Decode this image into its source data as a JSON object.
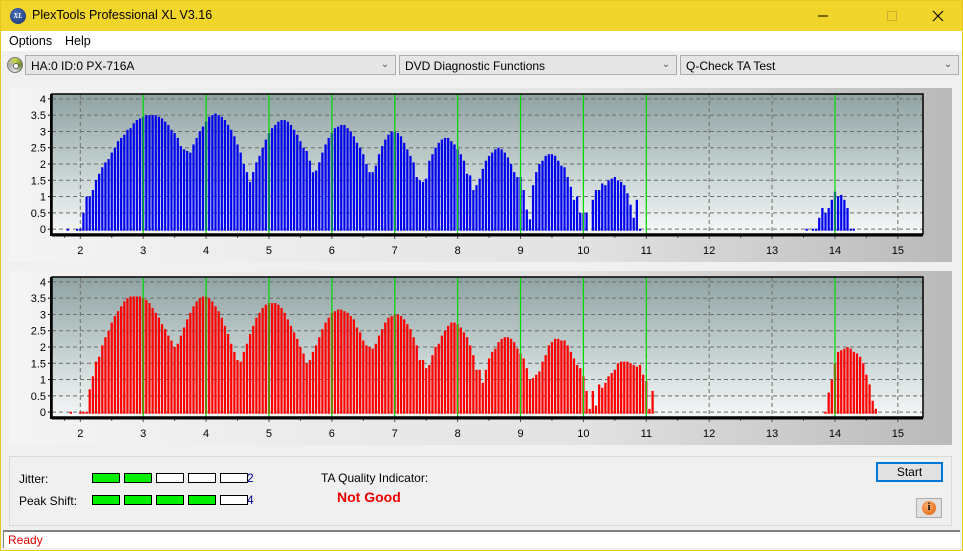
{
  "window": {
    "title": "PlexTools Professional XL V3.16",
    "app_icon_text": "XL",
    "minimize_icon": "minimize-icon",
    "maximize_icon": "maximize-icon",
    "close_icon": "close-icon"
  },
  "menu": {
    "items": [
      {
        "label": "Options"
      },
      {
        "label": "Help"
      }
    ]
  },
  "toolbar": {
    "drive_icon": "disc-drive-icon",
    "drive_select": {
      "value": "HA:0 ID:0  PX-716A"
    },
    "function_select": {
      "value": "DVD Diagnostic Functions"
    },
    "test_select": {
      "value": "Q-Check TA Test"
    }
  },
  "colors": {
    "title_bar": "#f2d52a",
    "top_series": "#0000ee",
    "bottom_series": "#ff0000",
    "marker_line": "#00dd00",
    "meter_on": "#00ee00",
    "quality_text": "#ee0000",
    "status_text": "#e00000"
  },
  "chart_data": [
    {
      "type": "bar",
      "title": "",
      "xlabel": "",
      "ylabel": "",
      "series_name": "top-histogram",
      "color": "#0000ee",
      "xlim": [
        1.55,
        15.4
      ],
      "ylim": [
        -0.15,
        4.15
      ],
      "xticks": [
        2,
        3,
        4,
        5,
        6,
        7,
        8,
        9,
        10,
        11,
        12,
        13,
        14,
        15
      ],
      "yticks": [
        0,
        0.5,
        1,
        1.5,
        2,
        2.5,
        3,
        3.5,
        4
      ],
      "ytick_labels": [
        "0",
        "0.5",
        "1",
        "1.5",
        "2",
        "2.5",
        "3",
        "3.5",
        "4"
      ],
      "marker_lines": [
        3,
        4,
        5,
        6,
        7,
        8,
        9,
        10,
        11,
        14
      ],
      "grid": true,
      "x_start": 1.8,
      "x_step": 0.05,
      "values": [
        0,
        null,
        null,
        0,
        0,
        0.5,
        1,
        1,
        1.2,
        1.5,
        1.7,
        1.9,
        2.05,
        2.15,
        2.35,
        2.5,
        2.7,
        2.8,
        2.9,
        3.05,
        3.1,
        3.25,
        3.35,
        3.4,
        3.45,
        3.5,
        3.5,
        3.5,
        3.5,
        3.45,
        3.4,
        3.3,
        3.2,
        3.05,
        2.95,
        2.8,
        2.55,
        2.45,
        2.4,
        2.35,
        2.6,
        2.8,
        3.0,
        3.15,
        3.3,
        3.45,
        3.5,
        3.55,
        3.5,
        3.45,
        3.35,
        3.2,
        3.05,
        2.85,
        2.6,
        2.35,
        2.0,
        1.75,
        1.45,
        1.75,
        2.05,
        2.25,
        2.5,
        2.75,
        2.95,
        3.1,
        3.2,
        3.3,
        3.35,
        3.35,
        3.3,
        3.2,
        3.05,
        2.9,
        2.7,
        2.5,
        2.4,
        2.1,
        1.75,
        1.8,
        2.05,
        2.35,
        2.6,
        2.8,
        2.95,
        3.1,
        3.15,
        3.2,
        3.2,
        3.1,
        3.0,
        2.85,
        2.65,
        2.5,
        2.3,
        2.0,
        1.75,
        1.75,
        1.95,
        2.3,
        2.55,
        2.75,
        2.9,
        3.0,
        3.0,
        2.95,
        2.85,
        2.65,
        2.45,
        2.25,
        2.05,
        1.6,
        1.5,
        1.45,
        1.55,
        2.1,
        2.3,
        2.5,
        2.65,
        2.75,
        2.8,
        2.8,
        2.7,
        2.6,
        2.45,
        2.3,
        2.1,
        1.7,
        1.65,
        1.2,
        1.35,
        1.55,
        1.85,
        2.1,
        2.25,
        2.35,
        2.45,
        2.5,
        2.45,
        2.35,
        2.2,
        2.0,
        1.75,
        1.6,
        1.6,
        1.2,
        0.6,
        0.3,
        1.35,
        1.75,
        2.0,
        2.1,
        2.25,
        2.3,
        2.3,
        2.25,
        2.1,
        1.95,
        1.9,
        1.6,
        1.3,
        0.9,
        1.0,
        0.5,
        0.5,
        0.5,
        null,
        0.9,
        1.2,
        1.2,
        1.4,
        1.35,
        1.5,
        1.55,
        1.6,
        1.5,
        1.45,
        1.35,
        1.1,
        0.75,
        0.35,
        0.9,
        0
      ],
      "values_b_start": 13.55,
      "values_b": [
        0,
        null,
        0,
        0,
        0.35,
        0.65,
        0.5,
        0.65,
        0.9,
        1.15,
        1.0,
        1.05,
        0.9,
        0.65,
        0,
        0
      ]
    },
    {
      "type": "bar",
      "title": "",
      "xlabel": "",
      "ylabel": "",
      "series_name": "bottom-histogram",
      "color": "#ff0000",
      "xlim": [
        1.55,
        15.4
      ],
      "ylim": [
        -0.15,
        4.15
      ],
      "xticks": [
        2,
        3,
        4,
        5,
        6,
        7,
        8,
        9,
        10,
        11,
        12,
        13,
        14,
        15
      ],
      "yticks": [
        0,
        0.5,
        1,
        1.5,
        2,
        2.5,
        3,
        3.5,
        4
      ],
      "ytick_labels": [
        "0",
        "0.5",
        "1",
        "1.5",
        "2",
        "2.5",
        "3",
        "3.5",
        "4"
      ],
      "marker_lines": [
        3,
        4,
        5,
        6,
        7,
        8,
        9,
        10,
        11,
        14
      ],
      "grid": true,
      "x_start": 1.85,
      "x_step": 0.05,
      "values": [
        0,
        null,
        null,
        0,
        0,
        0,
        0.7,
        1.1,
        1.55,
        1.7,
        2.05,
        2.3,
        2.5,
        2.75,
        2.95,
        3.1,
        3.25,
        3.4,
        3.5,
        3.55,
        3.55,
        3.55,
        3.55,
        3.5,
        3.45,
        3.35,
        3.2,
        3.05,
        2.9,
        2.7,
        2.55,
        2.35,
        2.2,
        2.0,
        2.1,
        2.35,
        2.6,
        2.85,
        3.05,
        3.25,
        3.4,
        3.5,
        3.55,
        3.55,
        3.5,
        3.4,
        3.25,
        3.1,
        2.9,
        2.65,
        2.4,
        2.1,
        1.85,
        1.6,
        1.55,
        1.85,
        2.1,
        2.4,
        2.65,
        2.9,
        3.05,
        3.2,
        3.3,
        3.35,
        3.35,
        3.35,
        3.3,
        3.2,
        3.05,
        2.85,
        2.65,
        2.45,
        2.25,
        2.0,
        1.8,
        1.5,
        1.6,
        1.85,
        2.05,
        2.3,
        2.55,
        2.75,
        2.9,
        3.05,
        3.1,
        3.15,
        3.15,
        3.1,
        3.05,
        2.95,
        2.85,
        2.6,
        2.45,
        2.2,
        2.05,
        2.0,
        1.95,
        2.1,
        2.35,
        2.55,
        2.75,
        2.9,
        2.95,
        3.0,
        3.0,
        2.95,
        2.85,
        2.7,
        2.55,
        2.3,
        2.05,
        1.6,
        1.6,
        1.35,
        1.45,
        1.75,
        2.0,
        2.1,
        2.35,
        2.5,
        2.65,
        2.75,
        2.75,
        2.7,
        2.6,
        2.45,
        2.3,
        2.05,
        1.75,
        1.3,
        1.3,
        0.9,
        1.3,
        1.65,
        1.85,
        1.95,
        2.15,
        2.25,
        2.3,
        2.3,
        2.25,
        2.15,
        1.95,
        1.8,
        1.65,
        1.35,
        1.0,
        1.05,
        1.15,
        1.25,
        1.55,
        1.75,
        2.05,
        2.15,
        2.25,
        2.25,
        2.2,
        2.2,
        2.05,
        1.85,
        1.65,
        1.45,
        1.35,
        1.1,
        0.65,
        0.1,
        0.65,
        0.2,
        0.85,
        0.75,
        0.9,
        1.1,
        1.2,
        1.3,
        1.5,
        1.55,
        1.55,
        1.55,
        1.5,
        1.45,
        1.4,
        1.45,
        1.15,
        0.95,
        0.1,
        0.65
      ],
      "values_b_start": 13.85,
      "values_b": [
        0,
        0.6,
        1.0,
        1.5,
        1.85,
        1.9,
        1.95,
        2.0,
        1.95,
        1.85,
        1.8,
        1.7,
        1.5,
        1.15,
        0.85,
        0.35,
        0.1
      ]
    }
  ],
  "metrics": {
    "jitter": {
      "label": "Jitter:",
      "value": "2",
      "level": 2,
      "max": 5
    },
    "peak_shift": {
      "label": "Peak Shift:",
      "value": "4",
      "level": 4,
      "max": 5
    }
  },
  "ta_quality": {
    "label": "TA Quality Indicator:",
    "value": "Not Good"
  },
  "buttons": {
    "start": "Start",
    "info_icon": "info-icon"
  },
  "status": {
    "text": "Ready"
  }
}
